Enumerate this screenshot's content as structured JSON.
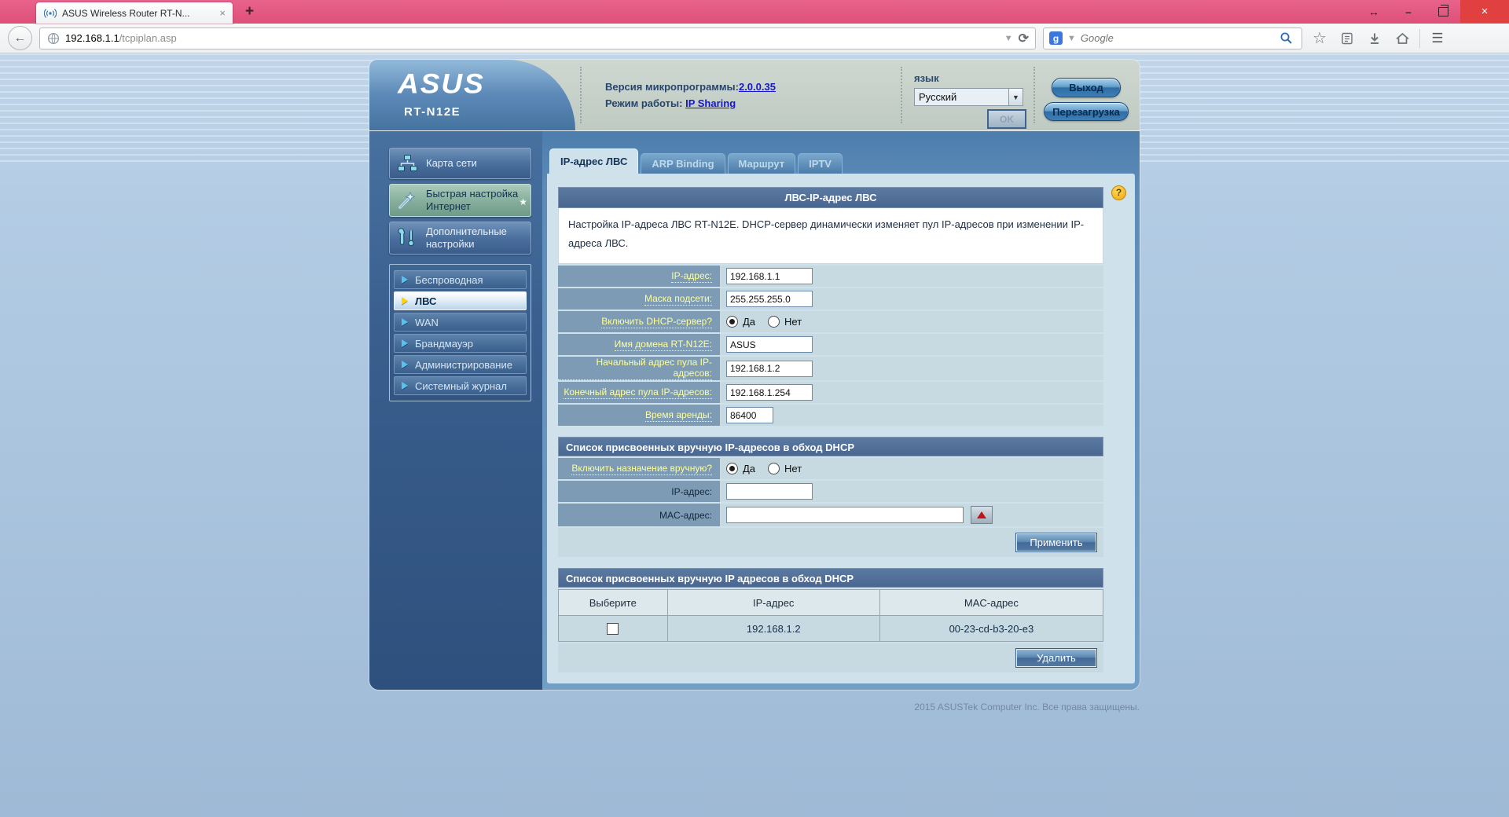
{
  "browser": {
    "tab": {
      "title": "ASUS Wireless Router RT-N...",
      "close_glyph": "×"
    },
    "new_tab_glyph": "+",
    "window": {
      "resize_glyph": "↔",
      "minimize_glyph": "–",
      "close_glyph": "×"
    },
    "url": {
      "host": "192.168.1.1",
      "path": "/tcpiplan.asp"
    },
    "search": {
      "placeholder": "Google",
      "engine_glyph": "g"
    }
  },
  "router": {
    "header": {
      "brand": "ASUS",
      "model": "RT-N12E",
      "firmware_label": "Версия микропрограммы:",
      "firmware_version": "2.0.0.35",
      "mode_label": "Режим работы:",
      "mode_value": "IP Sharing",
      "language_label": "язык",
      "language_value": "Русский",
      "ok_button": "OK",
      "logout_button": "Выход",
      "reboot_button": "Перезагрузка"
    },
    "sidebar": {
      "items": [
        {
          "label": "Карта сети"
        },
        {
          "label": "Быстрая настройка Интернет"
        },
        {
          "label": "Дополнительные настройки"
        }
      ],
      "subitems": [
        {
          "label": "Беспроводная"
        },
        {
          "label": "ЛВС"
        },
        {
          "label": "WAN"
        },
        {
          "label": "Брандмауэр"
        },
        {
          "label": "Администрирование"
        },
        {
          "label": "Системный журнал"
        }
      ]
    },
    "tabs": [
      {
        "label": "IP-адрес ЛВС"
      },
      {
        "label": "ARP Binding"
      },
      {
        "label": "Маршрут"
      },
      {
        "label": "IPTV"
      }
    ],
    "help_glyph": "?",
    "section_lan": {
      "title": "ЛВС-IP-адрес ЛВС",
      "description": "Настройка IP-адреса ЛВС RT-N12E. DHCP-сервер динамически изменяет пул IP-адресов при изменении IP-адреса ЛВС.",
      "ip_label": "IP-адрес:",
      "ip_value": "192.168.1.1",
      "mask_label": "Маска подсети:",
      "mask_value": "255.255.255.0",
      "dhcp_label": "Включить DHCP-сервер?",
      "yes_label": "Да",
      "no_label": "Нет",
      "domain_label": "Имя домена RT-N12E:",
      "domain_value": "ASUS",
      "pool_start_label": "Начальный адрес пула IP-адресов:",
      "pool_start_value": "192.168.1.2",
      "pool_end_label": "Конечный адрес пула IP-адресов:",
      "pool_end_value": "192.168.1.254",
      "lease_label": "Время аренды:",
      "lease_value": "86400"
    },
    "section_manual": {
      "title": "Список присвоенных вручную IP-адресов в обход DHCP",
      "enable_label": "Включить назначение вручную?",
      "yes_label": "Да",
      "no_label": "Нет",
      "ip_label": "IP-адрес:",
      "ip_value": "",
      "mac_label": "MAC-адрес:",
      "mac_value": "",
      "apply_button": "Применить"
    },
    "section_list": {
      "title": "Список присвоенных вручную IP адресов в обход DHCP",
      "columns": [
        "Выберите",
        "IP-адрес",
        "MAC-адрес"
      ],
      "rows": [
        {
          "ip": "192.168.1.2",
          "mac": "00-23-cd-b3-20-e3"
        }
      ],
      "delete_button": "Удалить"
    },
    "footer": "2015 ASUSTek Computer Inc. Все права защищены."
  }
}
